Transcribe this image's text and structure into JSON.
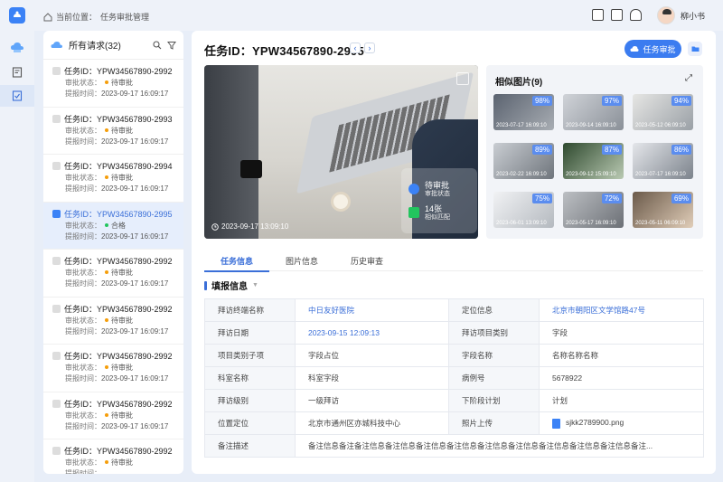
{
  "header": {
    "breadcrumb_prefix": "当前位置：",
    "breadcrumb_current": "任务审批管理",
    "user_name": "柳小书"
  },
  "requests_panel": {
    "title": "所有请求(32)",
    "items": [
      {
        "id": "任务ID：YPW34567890-2992",
        "status_label": "审批状态：",
        "status": "待审批",
        "time_label": "提报时间：",
        "time": "2023-09-17 16:09:17"
      },
      {
        "id": "任务ID：YPW34567890-2993",
        "status_label": "审批状态：",
        "status": "待审批",
        "time_label": "提报时间：",
        "time": "2023-09-17 16:09:17"
      },
      {
        "id": "任务ID：YPW34567890-2994",
        "status_label": "审批状态：",
        "status": "待审批",
        "time_label": "提报时间：",
        "time": "2023-09-17 16:09:17"
      },
      {
        "id": "任务ID：YPW34567890-2995",
        "status_label": "审批状态：",
        "status": "合格",
        "time_label": "提报时间：",
        "time": "2023-09-17 16:09:17"
      },
      {
        "id": "任务ID：YPW34567890-2992",
        "status_label": "审批状态：",
        "status": "待审批",
        "time_label": "提报时间：",
        "time": "2023-09-17 16:09:17"
      },
      {
        "id": "任务ID：YPW34567890-2992",
        "status_label": "审批状态：",
        "status": "待审批",
        "time_label": "提报时间：",
        "time": "2023-09-17 16:09:17"
      },
      {
        "id": "任务ID：YPW34567890-2992",
        "status_label": "审批状态：",
        "status": "待审批",
        "time_label": "提报时间：",
        "time": "2023-09-17 16:09:17"
      },
      {
        "id": "任务ID：YPW34567890-2992",
        "status_label": "审批状态：",
        "status": "待审批",
        "time_label": "提报时间：",
        "time": "2023-09-17 16:09:17"
      },
      {
        "id": "任务ID：YPW34567890-2992",
        "status_label": "审批状态：",
        "status": "待审批",
        "time_label": "提报时间：",
        "time": ""
      }
    ]
  },
  "main": {
    "task_title": "任务ID：YPW34567890-2995",
    "approve_button": "任务审批",
    "photo_timestamp": "2023-09-17 13:09:10",
    "overlay_status": "待审批",
    "overlay_status_sub": "审批状态",
    "overlay_count": "14张",
    "overlay_count_sub": "相似匹配",
    "similar_title": "相似图片(9)",
    "similar": [
      {
        "pct": "98%",
        "time": "2023-07-17 16:09:10"
      },
      {
        "pct": "97%",
        "time": "2023-09-14 16:09:10"
      },
      {
        "pct": "94%",
        "time": "2023-05-12 06:09:10"
      },
      {
        "pct": "89%",
        "time": "2023-02-22 16:09:10"
      },
      {
        "pct": "87%",
        "time": "2023-09-12 15:09:10"
      },
      {
        "pct": "86%",
        "time": "2023-07-17 16:09:10"
      },
      {
        "pct": "75%",
        "time": "2023-06-01 13:09:10"
      },
      {
        "pct": "72%",
        "time": "2023-05-17 16:09:10"
      },
      {
        "pct": "69%",
        "time": "2023-05-11 06:09:10"
      }
    ],
    "tabs": [
      "任务信息",
      "图片信息",
      "历史审查"
    ],
    "section_title": "填报信息",
    "rows": [
      [
        "拜访终端名称",
        "中日友好医院",
        "定位信息",
        "北京市朝阳区文学馆路47号"
      ],
      [
        "拜访日期",
        "2023-09-15 12:09:13",
        "拜访项目类别",
        "字段"
      ],
      [
        "项目类别子项",
        "字段占位",
        "字段名称",
        "名称名称名称"
      ],
      [
        "科室名称",
        "科室字段",
        "病例号",
        "5678922"
      ],
      [
        "拜访级别",
        "一级拜访",
        "下阶段计划",
        "计划"
      ],
      [
        "位置定位",
        "北京市通州区亦城科技中心",
        "照片上传",
        "sjkk2789900.png"
      ],
      [
        "备注描述",
        "备注信息备注备注信息备注信息备注信息备注信息备注信息备注信息备注信息备注信息备注信息备注..."
      ]
    ]
  }
}
